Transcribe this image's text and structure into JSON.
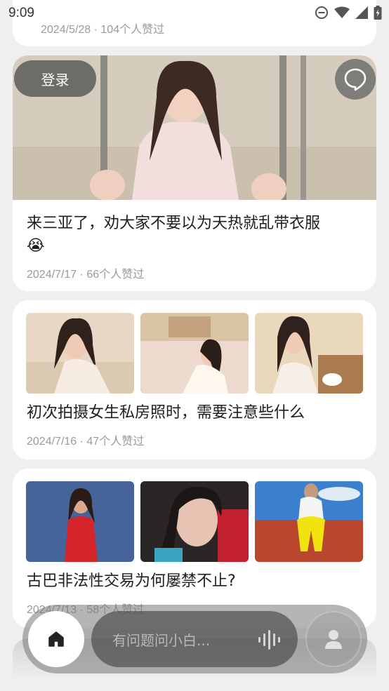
{
  "status_bar": {
    "time": "9:09"
  },
  "top_card": {
    "meta": "2024/5/28 · 104个人赞过"
  },
  "floating": {
    "login_label": "登录"
  },
  "posts": [
    {
      "title": "来三亚了，劝大家不要以为天热就乱带衣服",
      "emoji": "😭",
      "meta": "2024/7/17 · 66个人赞过"
    },
    {
      "title": "初次拍摄女生私房照时，需要注意些什么",
      "meta": "2024/7/16 · 47个人赞过"
    },
    {
      "title": "古巴非法性交易为何屡禁不止?",
      "meta": "2024/7/13 · 58个人赞过"
    }
  ],
  "bottom_nav": {
    "ask_placeholder": "有问题问小白..."
  }
}
